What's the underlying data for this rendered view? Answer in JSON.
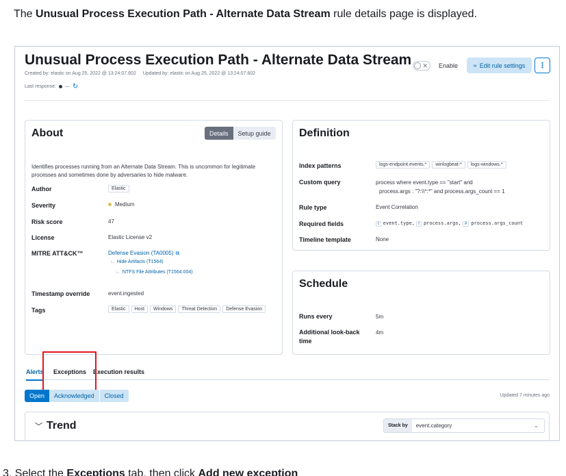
{
  "intro": {
    "prefix": "The ",
    "rule_name": "Unusual Process Execution Path - Alternate Data Stream",
    "suffix": " rule details page is displayed."
  },
  "header": {
    "title": "Unusual Process Execution Path - Alternate Data Stream",
    "created": "Created by: elastic on Aug 25, 2022 @ 13:24:07.602",
    "updated": "Updated by: elastic on Aug 25, 2022 @ 13:24:07.602",
    "last_response_label": "Last response:",
    "last_response_value": "—",
    "enable_label": "Enable",
    "edit_button": "Edit rule settings",
    "more_icon": "⋮",
    "toggle_off": "✕"
  },
  "about": {
    "title": "About",
    "tab_details": "Details",
    "tab_setup": "Setup guide",
    "description": "Identifies processes running from an Alternate Data Stream. This is uncommon for legitimate processes and sometimes done by adversaries to hide malware.",
    "rows": {
      "author_label": "Author",
      "author_value": "Elastic",
      "severity_label": "Severity",
      "severity_value": "Medium",
      "severity_color": "#d6bf57",
      "risk_label": "Risk score",
      "risk_value": "47",
      "license_label": "License",
      "license_value": "Elastic License v2",
      "mitre_label": "MITRE ATT&CK™",
      "mitre_tactic": "Defense Evasion (TA0005)",
      "mitre_technique": "Hide Artifacts (T1564)",
      "mitre_subtechnique": "NTFS File Attributes (T1564.004)",
      "timestamp_label": "Timestamp override",
      "timestamp_value": "event.ingested",
      "tags_label": "Tags",
      "tags": [
        "Elastic",
        "Host",
        "Windows",
        "Threat Detection",
        "Defense Evasion"
      ]
    }
  },
  "definition": {
    "title": "Definition",
    "index_label": "Index patterns",
    "index_patterns": [
      "logs-endpoint.events.*",
      "winlogbeat-*",
      "logs-windows.*"
    ],
    "query_label": "Custom query",
    "query_line1": "process where event.type == \"start\" and",
    "query_line2": "process.args : \"?:\\\\*:*\" and process.args_count == 1",
    "rule_type_label": "Rule type",
    "rule_type_value": "Event Correlation",
    "required_label": "Required fields",
    "required_fields": [
      "event.type,",
      "process.args,",
      "process.args_count"
    ],
    "required_types": [
      "t",
      "t",
      "#"
    ],
    "timeline_label": "Timeline template",
    "timeline_value": "None"
  },
  "schedule": {
    "title": "Schedule",
    "runs_label": "Runs every",
    "runs_value": "5m",
    "lookback_label_1": "Additional look-back",
    "lookback_label_2": "time",
    "lookback_value": "4m"
  },
  "tabs": {
    "alerts": "Alerts",
    "exceptions": "Exceptions",
    "execution": "Execution results"
  },
  "alerts_filter": {
    "open": "Open",
    "acknowledged": "Acknowledged",
    "closed": "Closed",
    "updated": "Updated 7 minutes ago"
  },
  "trend": {
    "title": "Trend",
    "stack_by_label": "Stack by",
    "stack_by_value": "event.category"
  },
  "step": {
    "number": "3.",
    "text_a": "Select the ",
    "bold_a": "Exceptions",
    "text_b": " tab, then click ",
    "bold_b": "Add new exception"
  }
}
